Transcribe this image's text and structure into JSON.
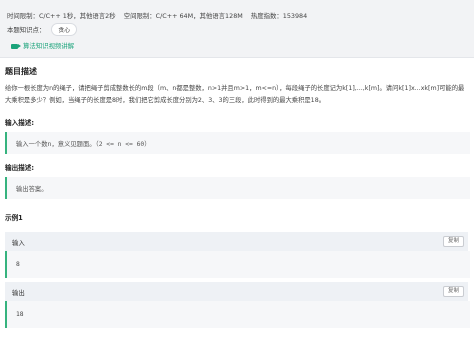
{
  "meta": {
    "time_limit": "时间限制：C/C++ 1秒，其他语言2秒",
    "space_limit": "空间限制：C/C++ 64M，其他语言128M",
    "heat": "热度指数：153984",
    "kp_label": "本题知识点：",
    "kp_tag": "贪心",
    "video_link": "算法知识视频讲解"
  },
  "problem": {
    "title": "题目描述",
    "description": "给你一根长度为n的绳子，请把绳子剪成整数长的m段（m、n都是整数，n>1并且m>1，m<=n），每段绳子的长度记为k[1],...,k[m]。请问k[1]x...xk[m]可能的最大乘积是多少？例如，当绳子的长度是8时，我们把它剪成长度分别为2、3、3的三段，此时得到的最大乘积是18。",
    "input_label": "输入描述:",
    "input_desc_prefix": "输入一个数n，意义见题面。",
    "input_desc_code": "（2 <= n <= 60）",
    "output_label": "输出描述:",
    "output_desc": "输出答案。"
  },
  "example": {
    "title": "示例1",
    "input_label": "输入",
    "input_value": "8",
    "output_label": "输出",
    "output_value": "18",
    "copy_label": "复制"
  },
  "colors": {
    "accent": "#36b37e",
    "link": "#1aa37a",
    "panel_bg": "#f2f3f5"
  }
}
